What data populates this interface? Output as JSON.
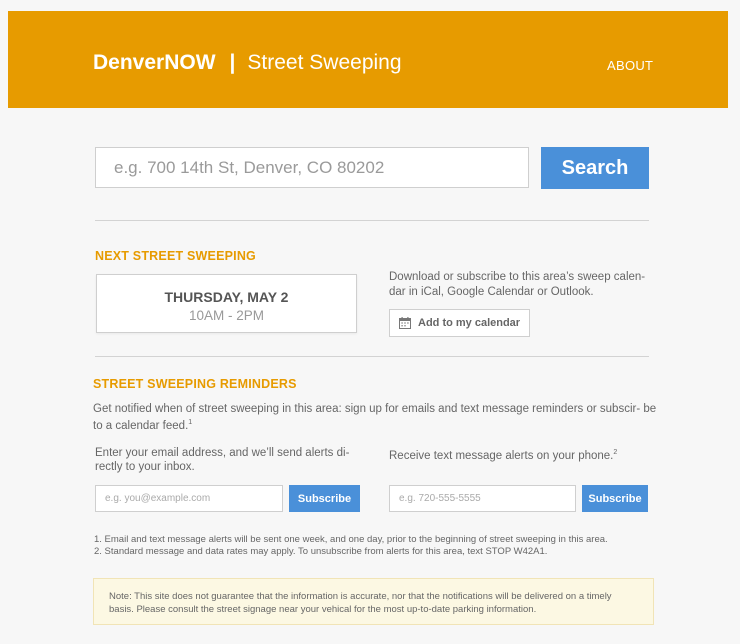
{
  "header": {
    "brand": "DenverNOW",
    "separator": "|",
    "subtitle": "Street Sweeping",
    "about_label": "ABOUT"
  },
  "search": {
    "placeholder": "e.g. 700 14th St, Denver, CO 80202",
    "button_label": "Search"
  },
  "next_sweeping": {
    "title": "NEXT STREET SWEEPING",
    "date": "THURSDAY, MAY 2",
    "time": "10AM - 2PM",
    "calendar_text": "Download or subscribe to this area’s sweep calen- dar in iCal, Google Calendar or Outlook.",
    "calendar_button": "Add to  my calendar",
    "calendar_icon": "calendar-icon"
  },
  "reminders": {
    "title": "STREET SWEEPING REMINDERS",
    "intro": "Get notified when of street sweeping in this area: sign up for emails and text message reminders or subscir- be to a calendar feed.",
    "intro_sup": "1",
    "email_text": "Enter your email address, and we’ll send alerts di- rectly to your inbox.",
    "email_placeholder": "e.g. you@example.com",
    "email_button": "Subscribe",
    "sms_text": "Receive text message alerts on your phone.",
    "sms_sup": "2",
    "sms_placeholder": "e.g. 720-555-5555",
    "sms_button": "Subscribe"
  },
  "footnotes": [
    "1. Email and text message alerts will be sent one week, and one day, prior to the beginning of street sweeping in this area.",
    "2. Standard message and data rates may apply. To unsubscribe from alerts for this area, text STOP W42A1."
  ],
  "note": "Note: This site does not guarantee that the information is accurate, nor that the notifications will be delivered on a timely basis. Please consult the street signage near your vehical for the most up-to-date parking information.",
  "colors": {
    "brand_orange": "#e79b00",
    "button_blue": "#4a90d9",
    "note_bg": "#fcf8e3"
  }
}
